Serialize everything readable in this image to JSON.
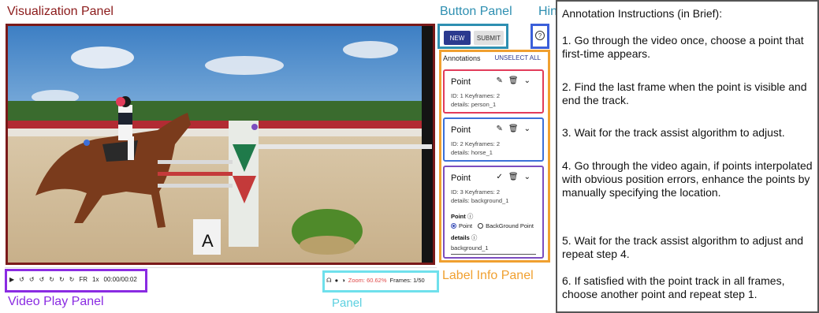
{
  "labels": {
    "visualization_panel": "Visualization Panel",
    "button_panel": "Button Panel",
    "hint": "Hint",
    "video_play_panel": "Video Play Panel",
    "panel": "Panel",
    "label_info_panel": "Label Info Panel"
  },
  "buttons": {
    "new": "NEW",
    "submit": "SUBMIT",
    "hint_icon": "?"
  },
  "annotations": {
    "header": "Annotations",
    "unselect_all": "UNSELECT ALL",
    "cards": [
      {
        "title": "Point",
        "id_line": "ID: 1 Keyframes: 2",
        "details": "details: person_1",
        "color": "#e23b5a",
        "icons": [
          "pencil-icon",
          "trash-icon",
          "chevron-down-icon"
        ]
      },
      {
        "title": "Point",
        "id_line": "ID: 2 Keyframes: 2",
        "details": "details: horse_1",
        "color": "#3b6fd9",
        "icons": [
          "pencil-icon",
          "trash-icon",
          "chevron-down-icon"
        ]
      },
      {
        "title": "Point",
        "id_line": "ID: 3 Keyframes: 2",
        "details": "details: background_1",
        "color": "#7c4dbf",
        "icons": [
          "check-icon",
          "trash-icon",
          "chevron-down-icon"
        ]
      }
    ],
    "editor": {
      "point_label": "Point",
      "option_point": "Point",
      "option_background": "BackGround Point",
      "details_label": "details",
      "details_value": "background_1"
    }
  },
  "video_controls": {
    "frame_rate_label": "FR",
    "speed": "1x",
    "time": "00:00/00:02"
  },
  "view_panel": {
    "zoom": "Zoom: 60.62%",
    "frames": "Frames: 1/50"
  },
  "instructions": {
    "title": "Annotation Instructions (in Brief):",
    "steps": [
      "1. Go through the video once, choose a point that first-time appears.",
      "2. Find the last frame when the point is visible and end the track.",
      "3. Wait for the track assist algorithm to adjust.",
      "4. Go through the video again, if points interpolated with obvious position errors, enhance the points by manually specifying the location.",
      "5. Wait for the track assist algorithm to adjust and repeat step 4.",
      "6. If satisfied with the point track in all frames, choose another point and repeat step 1."
    ]
  },
  "point_colors": {
    "person": "#e23b5a",
    "horse": "#3b6fd9",
    "background": "#7c4dbf"
  }
}
